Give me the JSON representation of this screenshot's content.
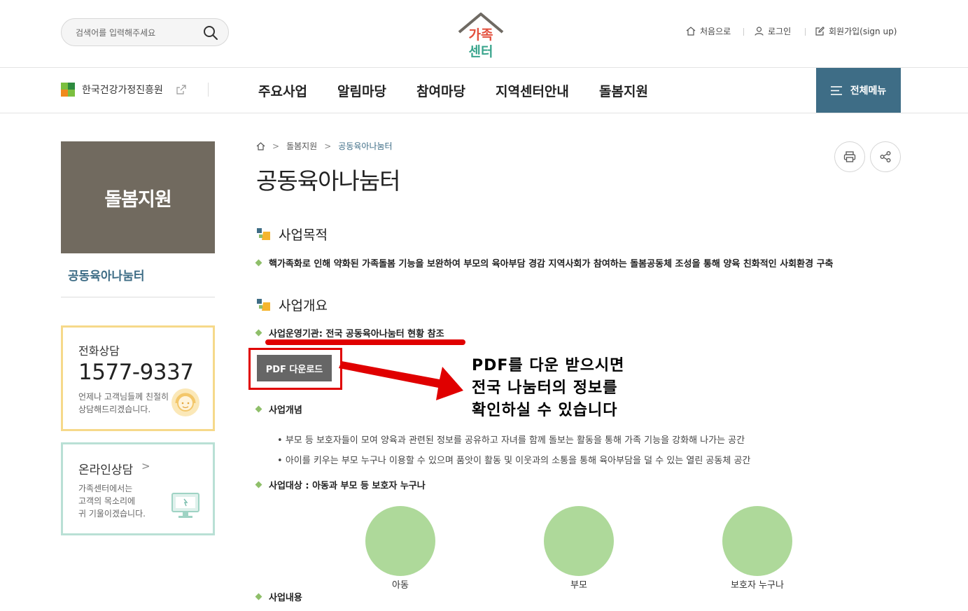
{
  "header": {
    "search_placeholder": "검색어를 입력해주세요",
    "logo_text_top": "가족",
    "logo_text_bottom": "센터",
    "util": {
      "home": "처음으로",
      "login": "로그인",
      "signup": "회원가입(sign up)"
    },
    "org_link": "한국건강가정진흥원",
    "nav": [
      "주요사업",
      "알림마당",
      "참여마당",
      "지역센터안내",
      "돌봄지원"
    ],
    "all_menu": "전체메뉴"
  },
  "sidebar": {
    "title": "돌봄지원",
    "items": [
      {
        "label": "공동육아나눔터"
      }
    ],
    "phone": {
      "label": "전화상담",
      "number": "1577-9337",
      "desc": "언제나 고객님들께 친절히 상담해드리겠습니다."
    },
    "online": {
      "label": "온라인상담",
      "arrow": ">",
      "desc_lines": [
        "가족센터에서는",
        "고객의 목소리에",
        "귀 기울이겠습니다."
      ]
    }
  },
  "breadcrumb": {
    "items": [
      "돌봄지원",
      "공동육아나눔터"
    ],
    "sep": ">"
  },
  "page": {
    "title": "공동육아나눔터",
    "sections": {
      "purpose": {
        "heading": "사업목적",
        "text": "핵가족화로 인해 약화된 가족돌봄 기능을 보완하여 부모의 육아부담 경감 지역사회가 참여하는 돌봄공동체 조성을 통해 양육 친화적인 사회환경 구축"
      },
      "overview": {
        "heading": "사업개요",
        "operator": "사업운영기관: 전국 공동육아나눔터 현황 참조",
        "pdf_button": "PDF 다운로드",
        "concept_title": "사업개념",
        "concept_items": [
          "부모 등 보호자들이 모여 양육과 관련된 정보를 공유하고 자녀를 함께 돌보는 활동을 통해 가족 기능을 강화해 나가는 공간",
          "아이를 키우는 부모 누구나 이용할 수 있으며 품앗이 활동 및 이웃과의 소통을 통해 육아부담을 덜 수 있는 열린 공동체 공간"
        ],
        "target_title": "사업대상 : 아동과 부모 등 보호자 누구나",
        "targets": [
          "아동",
          "부모",
          "보호자 누구나"
        ],
        "content_title": "사업내용"
      }
    }
  },
  "annotation": {
    "lines": [
      "PDF를 다운 받으시면",
      "전국 나눔터의 정보를",
      "확인하실 수 있습니다"
    ]
  },
  "colors": {
    "accent": "#3e6d86",
    "sidebar_title_bg": "#716a5f",
    "phone_border": "#f6d98a",
    "online_border": "#b9e0d5",
    "bullet": "#8fbf6a",
    "circle": "#aed99a",
    "highlight_red": "#e00000"
  }
}
